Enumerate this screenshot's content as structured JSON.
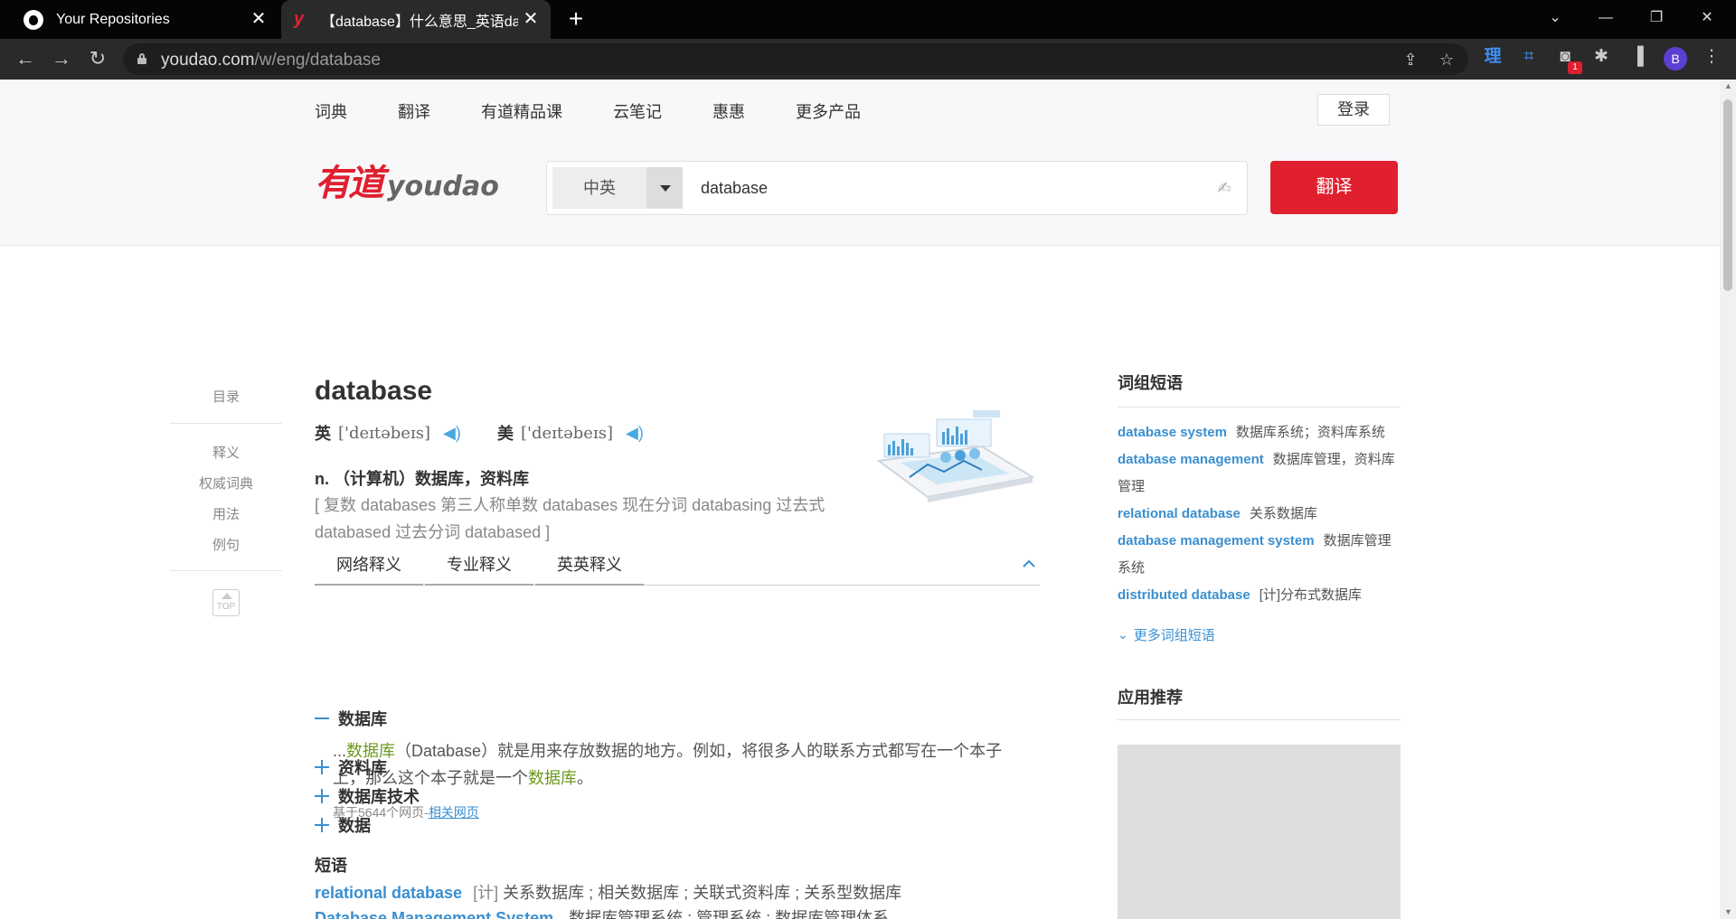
{
  "browser": {
    "tabs": [
      {
        "title": "Your Repositories",
        "close": "✕"
      },
      {
        "title": "【database】什么意思_英语database的翻译",
        "close": "✕"
      }
    ],
    "new_tab": "+",
    "url_domain": "youdao.com",
    "url_path": "/w/eng/database",
    "window_controls": {
      "dropdown": "⌄",
      "minimize": "—",
      "restore": "❐",
      "close": "✕"
    },
    "extensions": {
      "li_label": "理",
      "badge": "1"
    },
    "profile_initial": "B"
  },
  "site": {
    "nav": [
      "词典",
      "翻译",
      "有道精品课",
      "云笔记",
      "惠惠",
      "更多产品"
    ],
    "login": "登录",
    "logo_cn": "有道",
    "logo_en": "youdao",
    "lang_select": "中英",
    "search_value": "database",
    "translate_button": "翻译"
  },
  "toc": {
    "title": "目录",
    "items": [
      "释义",
      "权威词典",
      "用法",
      "例句"
    ],
    "top_label": "TOP"
  },
  "entry": {
    "word": "database",
    "uk_label": "英",
    "uk_ipa": "['deɪtəbeɪs]",
    "us_label": "美",
    "us_ipa": "['deɪtəbeɪs]",
    "definition": "n. （计算机）数据库，资料库",
    "forms": "[ 复数 databases 第三人称单数 databases 现在分词 databasing 过去式 databased 过去分词 databased ]",
    "tabs": [
      "网络释义",
      "专业释义",
      "英英释义"
    ],
    "sense1": {
      "title": "数据库",
      "text_prefix": "...",
      "hl1": "数据库",
      "text_mid": "（Database）就是用来存放数据的地方。例如，将很多人的联系方式都写在一个本子上，那么这个本子就是一个",
      "hl2": "数据库",
      "text_end": "。",
      "source_prefix": "基于5644个网页-",
      "source_link": "相关网页"
    },
    "senses_collapsed": [
      "资料库",
      "数据库技术",
      "数据"
    ],
    "phrases_title": "短语",
    "phrases": [
      {
        "en": "relational database",
        "tag": "[计]",
        "cn": " 关系数据库 ; 相关数据库 ; 关联式资料库 ; 关系型数据库"
      },
      {
        "en": "Database Management System",
        "tag": "",
        "cn": " 数据库管理系统 ; 管理系统 ; 数据库管理体系"
      }
    ]
  },
  "sidebar": {
    "phrases_title": "词组短语",
    "items": [
      {
        "en": "database system",
        "cn": "数据库系统；资料库系统"
      },
      {
        "en": "database management",
        "cn": "数据库管理，资料库管理"
      },
      {
        "en": "relational database",
        "cn": "关系数据库"
      },
      {
        "en": "database management system",
        "cn": "数据库管理系统"
      },
      {
        "en": "distributed database",
        "cn": "[计]分布式数据库"
      }
    ],
    "more": "更多词组短语",
    "apps_title": "应用推荐"
  },
  "colors": {
    "brand_red": "#e0202f",
    "link_blue": "#3a8fd0",
    "highlight_green": "#6b9a1c"
  }
}
